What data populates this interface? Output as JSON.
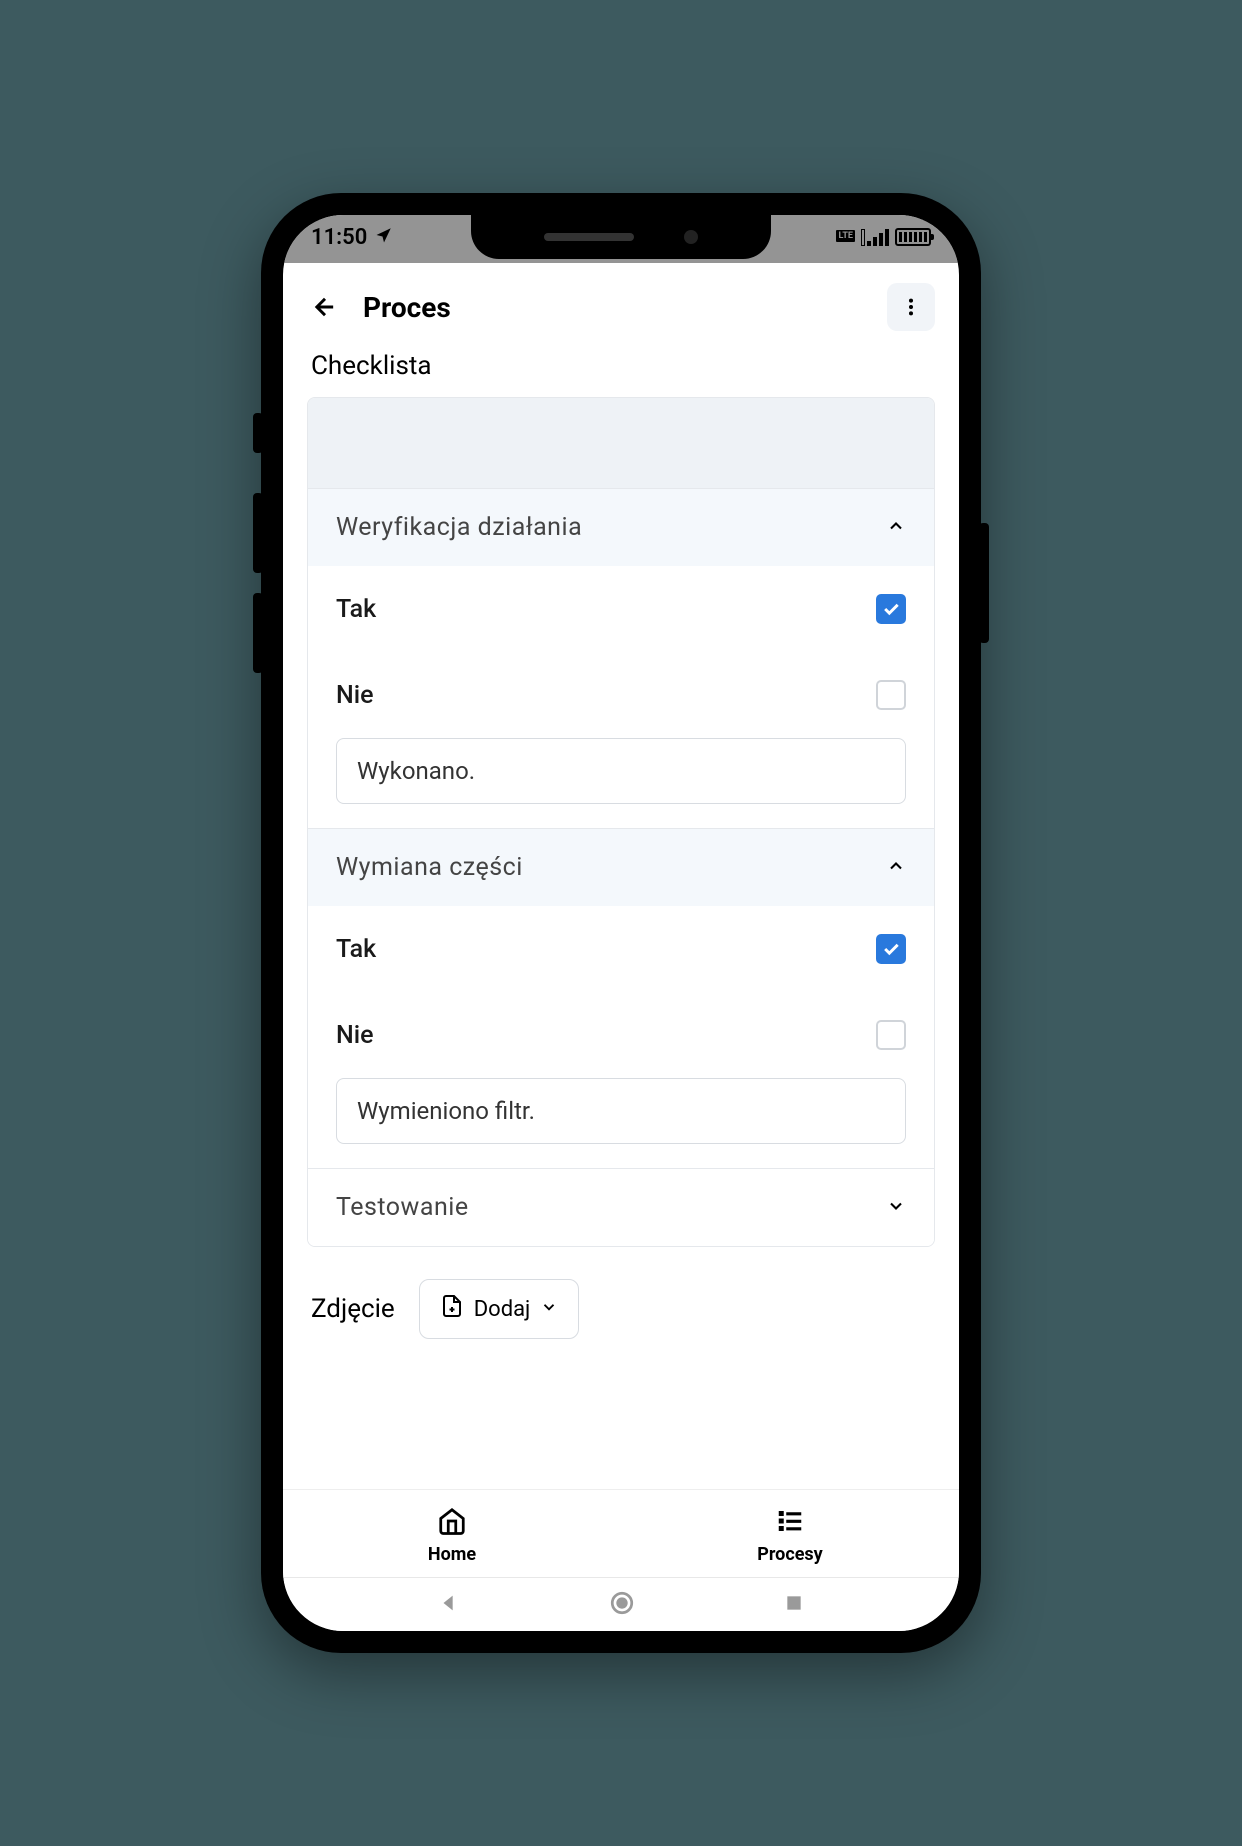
{
  "status": {
    "time": "11:50"
  },
  "header": {
    "title": "Proces"
  },
  "section": {
    "checklist_label": "Checklista",
    "photo_label": "Zdjęcie",
    "add_button": "Dodaj"
  },
  "sections": [
    {
      "title": "Weryfikacja działania",
      "yes_label": "Tak",
      "yes_checked": true,
      "no_label": "Nie",
      "no_checked": false,
      "note": "Wykonano.",
      "expanded": true
    },
    {
      "title": "Wymiana części",
      "yes_label": "Tak",
      "yes_checked": true,
      "no_label": "Nie",
      "no_checked": false,
      "note": "Wymieniono filtr.",
      "expanded": true
    },
    {
      "title": "Testowanie",
      "expanded": false
    }
  ],
  "nav": {
    "home": "Home",
    "procesy": "Procesy"
  },
  "colors": {
    "accent": "#2979dd",
    "bg_header": "#f4f8fc",
    "border": "#e5e8ec"
  }
}
